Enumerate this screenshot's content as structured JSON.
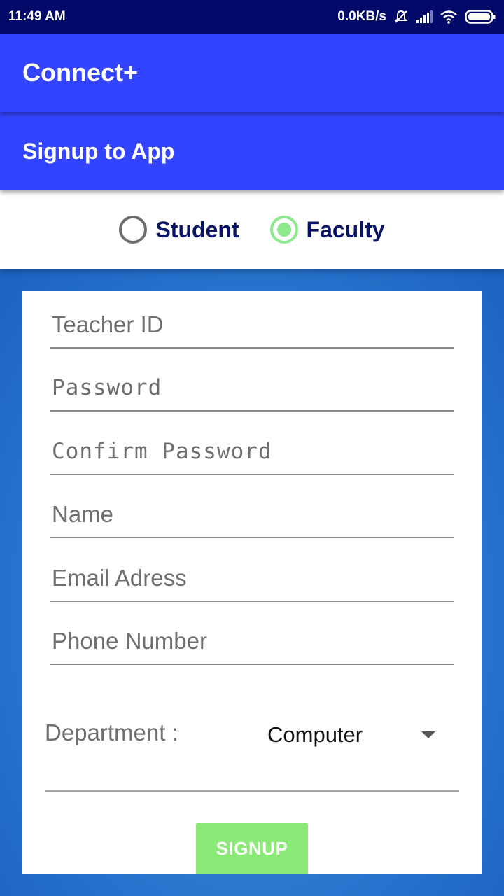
{
  "status_bar": {
    "time": "11:49 AM",
    "net_speed": "0.0KB/s",
    "icons": [
      "mute-icon",
      "signal-icon",
      "wifi-icon",
      "battery-icon"
    ]
  },
  "app_bar": {
    "title": "Connect+"
  },
  "sub_bar": {
    "title": "Signup to App"
  },
  "role": {
    "options": [
      {
        "label": "Student",
        "checked": false
      },
      {
        "label": "Faculty",
        "checked": true
      }
    ]
  },
  "form": {
    "teacher_id": {
      "placeholder": "Teacher ID",
      "value": ""
    },
    "password": {
      "placeholder": "Password",
      "value": ""
    },
    "confirm_password": {
      "placeholder": "Confirm Password",
      "value": ""
    },
    "name": {
      "placeholder": "Name",
      "value": ""
    },
    "email": {
      "placeholder": "Email Adress",
      "value": ""
    },
    "phone": {
      "placeholder": "Phone Number",
      "value": ""
    },
    "department": {
      "label": "Department :",
      "selected": "Computer"
    },
    "signup_label": "SIGNUP"
  },
  "colors": {
    "status_bar": "#010a68",
    "app_bar": "#3344fe",
    "radio_checked": "#8ee88e",
    "signup_button": "#8be977"
  }
}
